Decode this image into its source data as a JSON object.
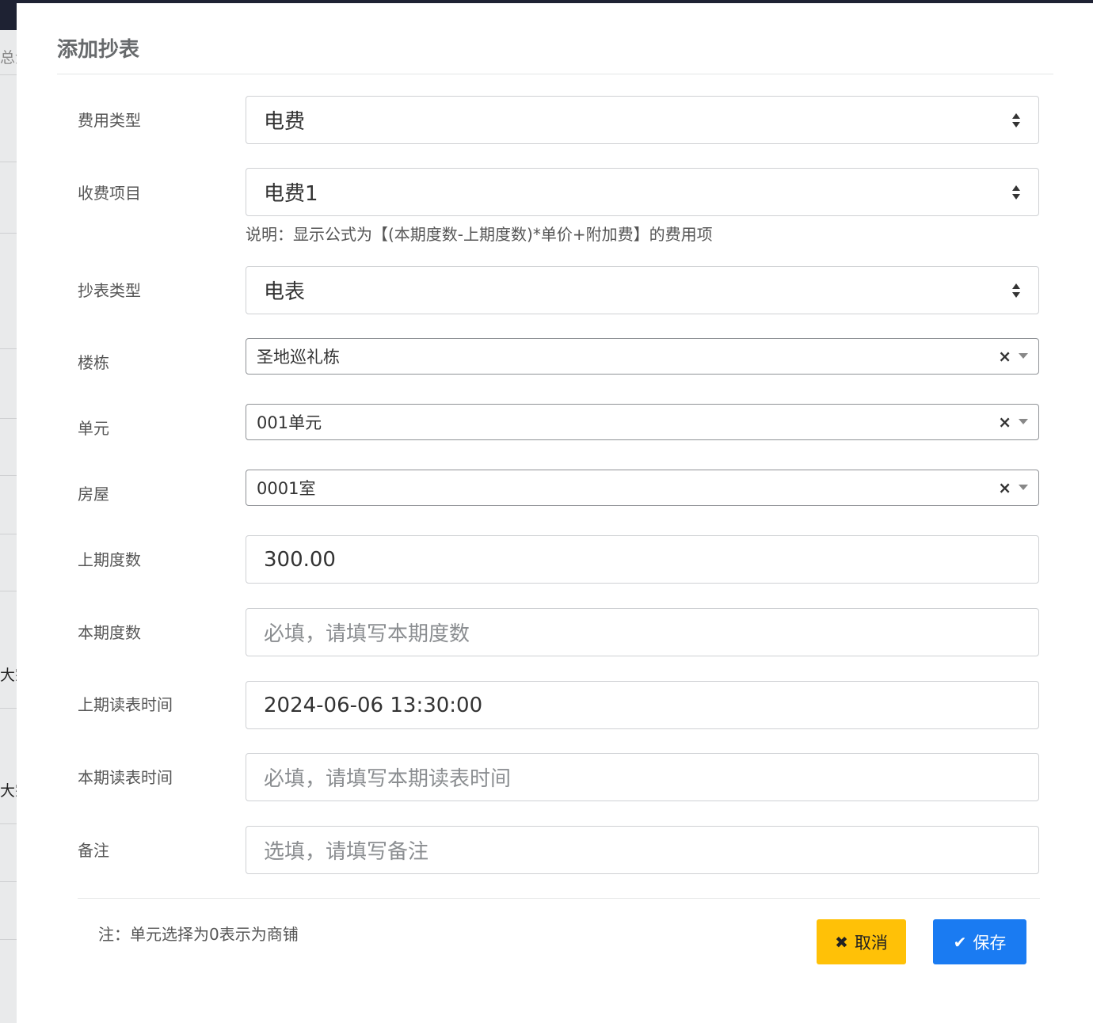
{
  "background": {
    "fragments": [
      "总金",
      "大宗",
      "大宗"
    ]
  },
  "modal": {
    "title": "添加抄表",
    "fields": {
      "fee_type": {
        "label": "费用类型",
        "value": "电费"
      },
      "charge_item": {
        "label": "收费项目",
        "value": "电费1",
        "hint": "说明：显示公式为【(本期度数-上期度数)*单价+附加费】的费用项"
      },
      "meter_type": {
        "label": "抄表类型",
        "value": "电表"
      },
      "building": {
        "label": "楼栋",
        "value": "圣地巡礼栋"
      },
      "unit": {
        "label": "单元",
        "value": "001单元"
      },
      "room": {
        "label": "房屋",
        "value": "0001室"
      },
      "prev_reading": {
        "label": "上期度数",
        "value": "300.00"
      },
      "curr_reading": {
        "label": "本期度数",
        "placeholder": "必填，请填写本期度数"
      },
      "prev_time": {
        "label": "上期读表时间",
        "value": "2024-06-06 13:30:00"
      },
      "curr_time": {
        "label": "本期读表时间",
        "placeholder": "必填，请填写本期读表时间"
      },
      "remark": {
        "label": "备注",
        "placeholder": "选填，请填写备注"
      }
    },
    "clear_symbol": "×",
    "footer": {
      "note": "注：单元选择为0表示为商铺",
      "cancel_icon": "✖",
      "cancel_label": "取消",
      "save_icon": "✔",
      "save_label": "保存"
    }
  }
}
